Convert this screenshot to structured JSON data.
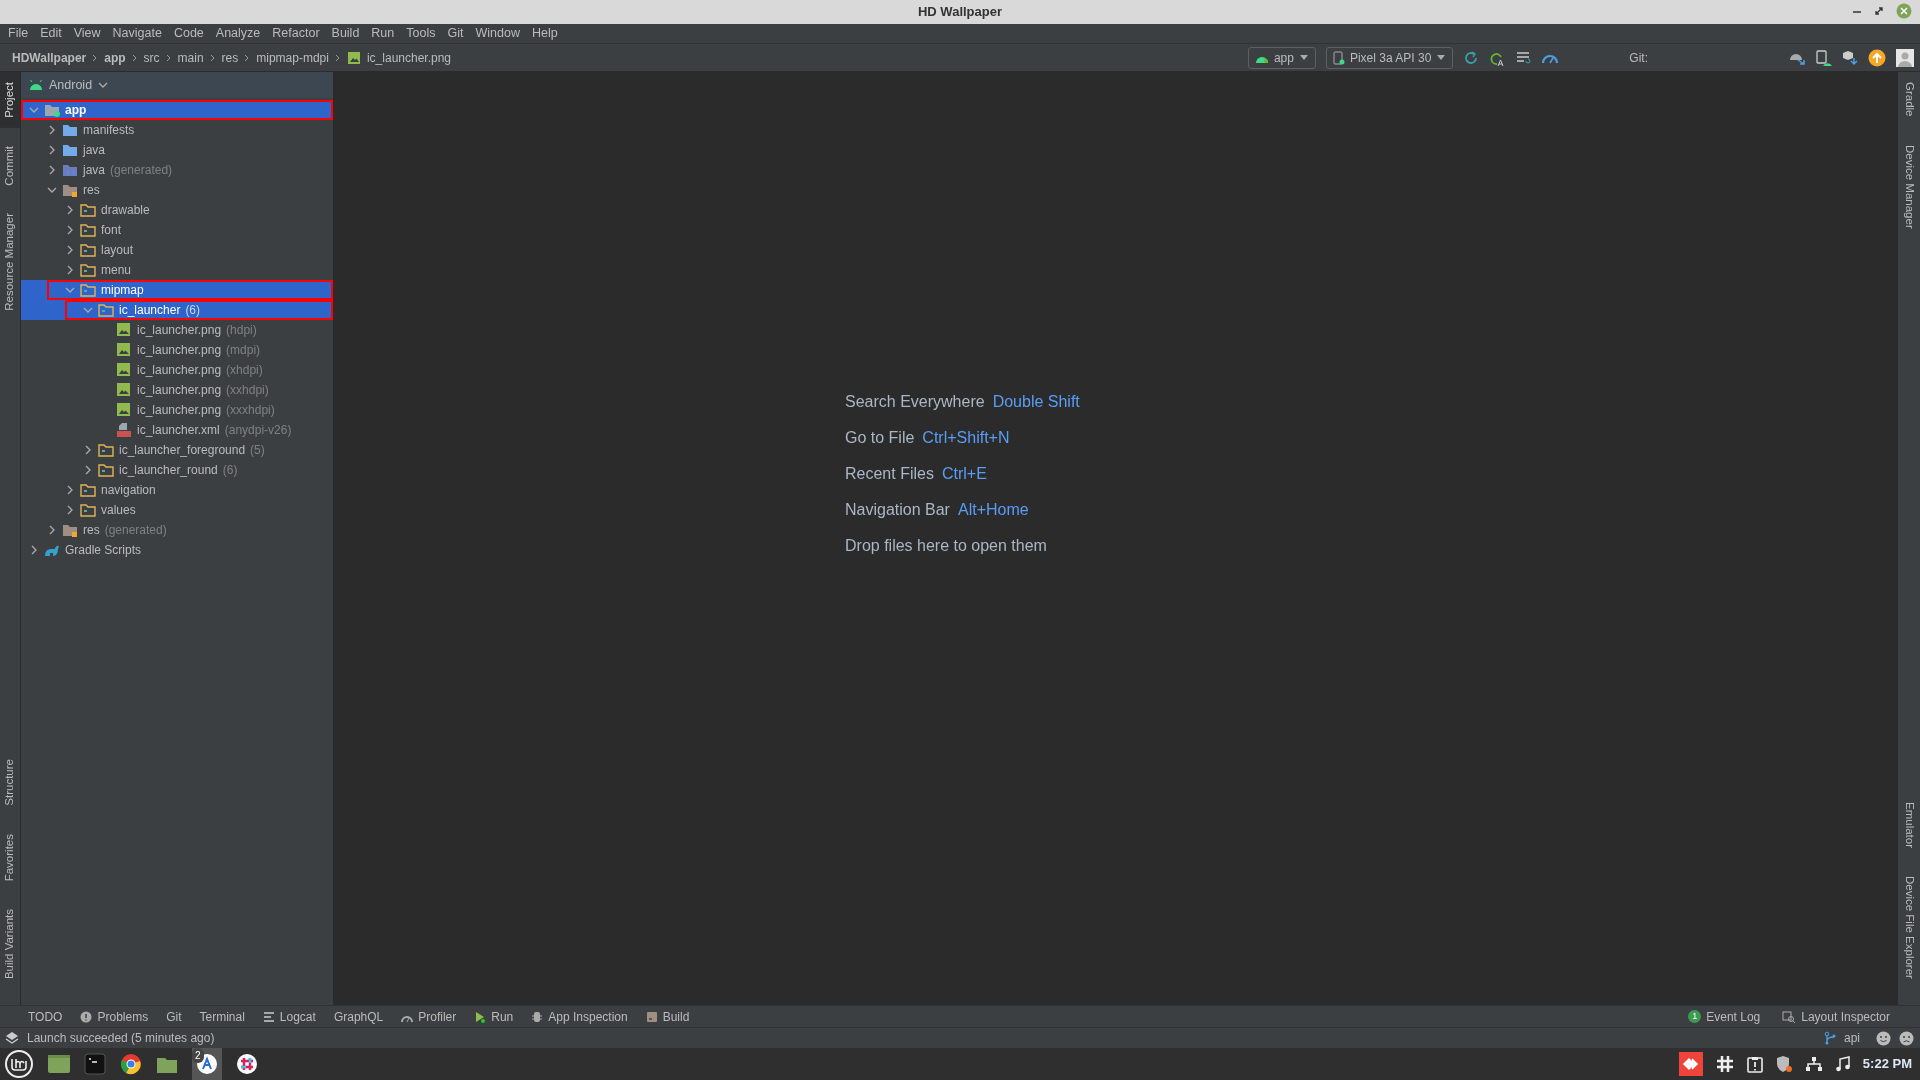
{
  "window": {
    "title": "HD Wallpaper"
  },
  "menu": [
    "File",
    "Edit",
    "View",
    "Navigate",
    "Code",
    "Analyze",
    "Refactor",
    "Build",
    "Run",
    "Tools",
    "Git",
    "Window",
    "Help"
  ],
  "breadcrumb": [
    {
      "label": "HDWallpaper",
      "bold": true
    },
    {
      "label": "app",
      "bold": true
    },
    {
      "label": "src",
      "bold": false
    },
    {
      "label": "main",
      "bold": false
    },
    {
      "label": "res",
      "bold": false
    },
    {
      "label": "mipmap-mdpi",
      "bold": false
    },
    {
      "label": "ic_launcher.png",
      "bold": false,
      "kind": "image"
    }
  ],
  "toolbar": {
    "run_config": "app",
    "device": "Pixel 3a API 30",
    "git_label": "Git:"
  },
  "left_tabs": [
    {
      "label": "Project",
      "selected": true
    },
    {
      "label": "Commit",
      "selected": false
    },
    {
      "label": "Resource Manager",
      "selected": false
    }
  ],
  "left_tabs_bottom": [
    {
      "label": "Structure",
      "selected": false
    },
    {
      "label": "Favorites",
      "selected": false
    },
    {
      "label": "Build Variants",
      "selected": false
    }
  ],
  "right_tabs": [
    {
      "label": "Gradle"
    },
    {
      "label": "Device Manager"
    }
  ],
  "right_tabs_bottom": [
    {
      "label": "Emulator"
    },
    {
      "label": "Device File Explorer"
    }
  ],
  "project_panel": {
    "view": "Android",
    "tree": [
      {
        "label": "app",
        "kind": "module",
        "expanded": true,
        "selected": true,
        "marked": true,
        "children": [
          {
            "label": "manifests",
            "kind": "folder",
            "expanded": false,
            "selected": false,
            "marked": false
          },
          {
            "label": "java",
            "kind": "folder",
            "expanded": false,
            "selected": false,
            "marked": false
          },
          {
            "label": "java",
            "note": "(generated)",
            "kind": "java-generated",
            "expanded": false,
            "selected": false,
            "marked": false
          },
          {
            "label": "res",
            "kind": "res",
            "expanded": true,
            "selected": false,
            "marked": false,
            "children": [
              {
                "label": "drawable",
                "kind": "res-dir",
                "expanded": false,
                "selected": false,
                "marked": false
              },
              {
                "label": "font",
                "kind": "res-dir",
                "expanded": false,
                "selected": false,
                "marked": false
              },
              {
                "label": "layout",
                "kind": "res-dir",
                "expanded": false,
                "selected": false,
                "marked": false
              },
              {
                "label": "menu",
                "kind": "res-dir",
                "expanded": false,
                "selected": false,
                "marked": false
              },
              {
                "label": "mipmap",
                "kind": "res-dir",
                "expanded": true,
                "selected": true,
                "marked": true,
                "children": [
                  {
                    "label": "ic_launcher",
                    "note": "(6)",
                    "kind": "res-dir",
                    "expanded": true,
                    "selected": true,
                    "marked": true,
                    "children": [
                      {
                        "label": "ic_launcher.png",
                        "note": "(hdpi)",
                        "kind": "image",
                        "selected": false,
                        "marked": false
                      },
                      {
                        "label": "ic_launcher.png",
                        "note": "(mdpi)",
                        "kind": "image",
                        "selected": false,
                        "marked": false
                      },
                      {
                        "label": "ic_launcher.png",
                        "note": "(xhdpi)",
                        "kind": "image",
                        "selected": false,
                        "marked": false
                      },
                      {
                        "label": "ic_launcher.png",
                        "note": "(xxhdpi)",
                        "kind": "image",
                        "selected": false,
                        "marked": false
                      },
                      {
                        "label": "ic_launcher.png",
                        "note": "(xxxhdpi)",
                        "kind": "image",
                        "selected": false,
                        "marked": false
                      },
                      {
                        "label": "ic_launcher.xml",
                        "note": "(anydpi-v26)",
                        "kind": "xml",
                        "selected": false,
                        "marked": false
                      }
                    ]
                  },
                  {
                    "label": "ic_launcher_foreground",
                    "note": "(5)",
                    "kind": "res-dir",
                    "expanded": false,
                    "selected": false,
                    "marked": false
                  },
                  {
                    "label": "ic_launcher_round",
                    "note": "(6)",
                    "kind": "res-dir",
                    "expanded": false,
                    "selected": false,
                    "marked": false
                  }
                ]
              },
              {
                "label": "navigation",
                "kind": "res-dir",
                "expanded": false,
                "selected": false,
                "marked": false
              },
              {
                "label": "values",
                "kind": "res-dir",
                "expanded": false,
                "selected": false,
                "marked": false
              }
            ]
          },
          {
            "label": "res",
            "note": "(generated)",
            "kind": "res",
            "expanded": false,
            "selected": false,
            "marked": false
          }
        ]
      },
      {
        "label": "Gradle Scripts",
        "kind": "gradle",
        "expanded": false,
        "selected": false,
        "marked": false
      }
    ]
  },
  "editor_hints": [
    {
      "label": "Search Everywhere",
      "shortcut": "Double Shift"
    },
    {
      "label": "Go to File",
      "shortcut": "Ctrl+Shift+N"
    },
    {
      "label": "Recent Files",
      "shortcut": "Ctrl+E"
    },
    {
      "label": "Navigation Bar",
      "shortcut": "Alt+Home"
    },
    {
      "label": "Drop files here to open them"
    }
  ],
  "bottom_tools": [
    {
      "label": "TODO",
      "kind": "plain"
    },
    {
      "label": "Problems",
      "kind": "problems"
    },
    {
      "label": "Git",
      "kind": "plain"
    },
    {
      "label": "Terminal",
      "kind": "plain"
    },
    {
      "label": "Logcat",
      "kind": "logcat"
    },
    {
      "label": "GraphQL",
      "kind": "plain"
    },
    {
      "label": "Profiler",
      "kind": "profiler"
    },
    {
      "label": "Run",
      "kind": "run"
    },
    {
      "label": "App Inspection",
      "kind": "inspection"
    },
    {
      "label": "Build",
      "kind": "build"
    }
  ],
  "bottom_tools_right": [
    {
      "label": "Event Log",
      "badge": "1"
    },
    {
      "label": "Layout Inspector"
    }
  ],
  "status_bar": {
    "message": "Launch succeeded (5 minutes ago)",
    "branch": "api"
  },
  "taskbar": {
    "badge": "2",
    "clock": "5:22 PM"
  }
}
